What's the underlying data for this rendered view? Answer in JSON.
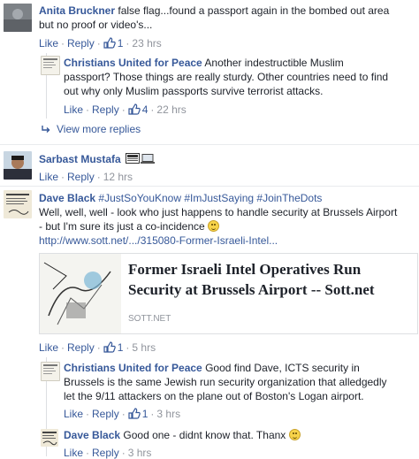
{
  "actions": {
    "like": "Like",
    "reply": "Reply",
    "sep": "·"
  },
  "comments": [
    {
      "author": "Anita Bruckner",
      "text_line1": "false flag...found a passport again in the bombed out area",
      "text_line2": "but no proof or video's...",
      "likes": "1",
      "time": "23 hrs"
    },
    {
      "author": "Christians United for Peace",
      "text_line1": "Another indestructible Muslim",
      "text_line2": "passport? Those things are really sturdy. Other countries need to find",
      "text_line3": "out why only Muslim passports survive terrorist attacks.",
      "likes": "4",
      "time": "22 hrs"
    },
    {
      "view_more": "View more replies"
    },
    {
      "author": "Sarbast Mustafa",
      "time": "12 hrs"
    },
    {
      "author": "Dave Black",
      "hashtags": "#JustSoYouKnow #ImJustSaying #JoinTheDots",
      "text_line1": "Well, well, well - look who just happens to handle security at Brussels Airport",
      "text_line2": "- but I'm sure its just a co-incidence",
      "url": "http://www.sott.net/.../315080-Former-Israeli-Intel...",
      "card_title_line1": "Former Israeli Intel Operatives Run",
      "card_title_line2": "Security at Brussels Airport -- Sott.net",
      "card_source": "SOTT.NET",
      "likes": "1",
      "time": "5 hrs"
    },
    {
      "author": "Christians United for Peace",
      "text_line1": "Good find Dave, ICTS security in",
      "text_line2": "Brussels is the same Jewish run security organization that alledgedly",
      "text_line3": "let the 9/11 attackers on the plane out of Boston's Logan airport.",
      "likes": "1",
      "time": "3 hrs"
    },
    {
      "author": "Dave Black",
      "text_line1": "Good one - didnt know that. Thanx",
      "time": "3 hrs"
    }
  ]
}
